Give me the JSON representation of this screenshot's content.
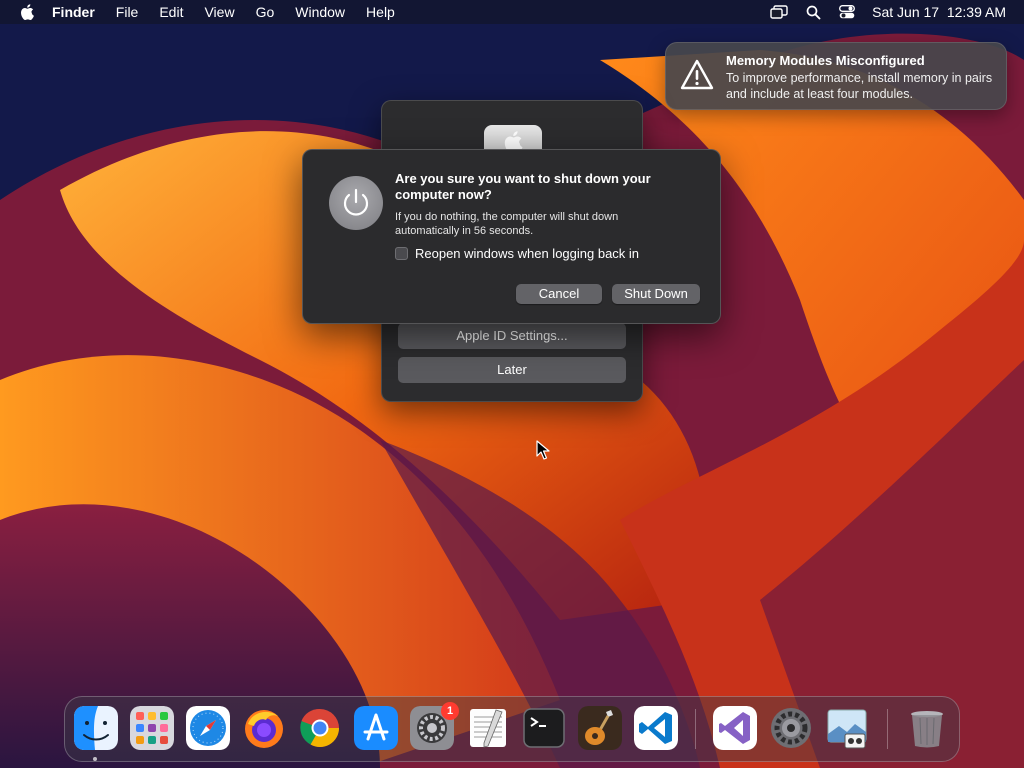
{
  "menubar": {
    "app_name": "Finder",
    "menus": [
      "File",
      "Edit",
      "View",
      "Go",
      "Window",
      "Help"
    ],
    "datetime": "Sat Jun 17  12:39 AM"
  },
  "notification": {
    "title": "Memory Modules Misconfigured",
    "body": "To improve performance, install memory in pairs and include at least four modules."
  },
  "background_dialog": {
    "apple_id_settings_label": "Apple ID Settings...",
    "later_label": "Later"
  },
  "shutdown_dialog": {
    "heading": "Are you sure you want to shut down your computer now?",
    "info": "If you do nothing, the computer will shut down automatically in 56 seconds.",
    "reopen_label": "Reopen windows when logging back in",
    "reopen_checked": false,
    "cancel_label": "Cancel",
    "shutdown_label": "Shut Down"
  },
  "dock": {
    "apps": [
      "finder-icon",
      "launchpad-icon",
      "safari-icon",
      "firefox-icon",
      "chrome-icon",
      "app-store-icon",
      "system-preferences-icon",
      "textedit-icon",
      "terminal-icon",
      "garageband-icon",
      "vscode-icon",
      "visual-studio-icon",
      "settings-gear-icon",
      "preview-icon",
      "trash-icon"
    ],
    "system_preferences_badge": "1"
  }
}
